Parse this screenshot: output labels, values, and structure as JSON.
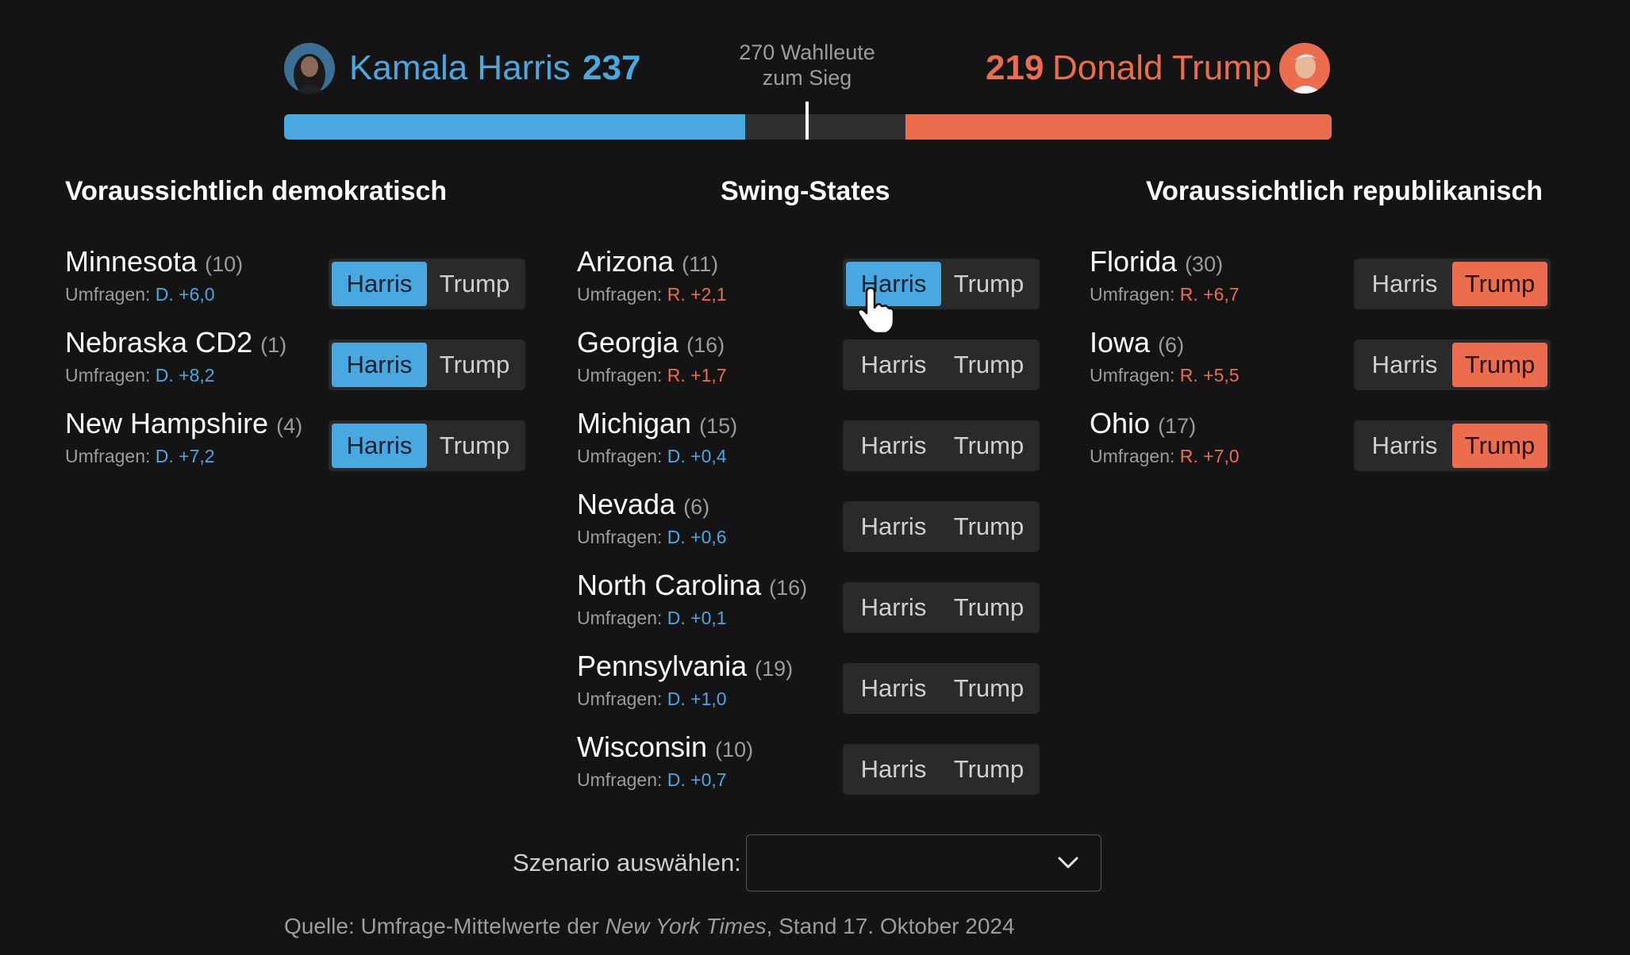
{
  "header": {
    "harris": {
      "name": "Kamala Harris",
      "votes": "237",
      "color": "#4aa8e0"
    },
    "trump": {
      "name": "Donald Trump",
      "votes": "219",
      "color": "#ec6c4e"
    },
    "threshold": {
      "line1": "270 Wahlleute",
      "line2": "zum Sieg"
    },
    "progress": {
      "total": 538,
      "harris": 237,
      "trump": 219,
      "threshold": 270
    }
  },
  "columns": {
    "dem": {
      "title": "Voraussichtlich demokratisch",
      "states": [
        {
          "name": "Minnesota",
          "ev": "(10)",
          "poll_prefix": "Umfragen:",
          "poll": "D. +6,0",
          "selected": "Harris"
        },
        {
          "name": "Nebraska CD2",
          "ev": "(1)",
          "poll_prefix": "Umfragen:",
          "poll": "D. +8,2",
          "selected": "Harris"
        },
        {
          "name": "New Hampshire",
          "ev": "(4)",
          "poll_prefix": "Umfragen:",
          "poll": "D. +7,2",
          "selected": "Harris"
        }
      ]
    },
    "swing": {
      "title": "Swing-States",
      "states": [
        {
          "name": "Arizona",
          "ev": "(11)",
          "poll_prefix": "Umfragen:",
          "poll": "R. +2,1",
          "selected": "Harris"
        },
        {
          "name": "Georgia",
          "ev": "(16)",
          "poll_prefix": "Umfragen:",
          "poll": "R. +1,7",
          "selected": ""
        },
        {
          "name": "Michigan",
          "ev": "(15)",
          "poll_prefix": "Umfragen:",
          "poll": "D. +0,4",
          "selected": ""
        },
        {
          "name": "Nevada",
          "ev": "(6)",
          "poll_prefix": "Umfragen:",
          "poll": "D. +0,6",
          "selected": ""
        },
        {
          "name": "North Carolina",
          "ev": "(16)",
          "poll_prefix": "Umfragen:",
          "poll": "D. +0,1",
          "selected": ""
        },
        {
          "name": "Pennsylvania",
          "ev": "(19)",
          "poll_prefix": "Umfragen:",
          "poll": "D. +1,0",
          "selected": ""
        },
        {
          "name": "Wisconsin",
          "ev": "(10)",
          "poll_prefix": "Umfragen:",
          "poll": "D. +0,7",
          "selected": ""
        }
      ]
    },
    "rep": {
      "title": "Voraussichtlich republikanisch",
      "states": [
        {
          "name": "Florida",
          "ev": "(30)",
          "poll_prefix": "Umfragen:",
          "poll": "R. +6,7",
          "selected": "Trump"
        },
        {
          "name": "Iowa",
          "ev": "(6)",
          "poll_prefix": "Umfragen:",
          "poll": "R. +5,5",
          "selected": "Trump"
        },
        {
          "name": "Ohio",
          "ev": "(17)",
          "poll_prefix": "Umfragen:",
          "poll": "R. +7,0",
          "selected": "Trump"
        }
      ]
    }
  },
  "toggle_labels": {
    "harris": "Harris",
    "trump": "Trump"
  },
  "scenario": {
    "label": "Szenario auswählen:",
    "value": ""
  },
  "source": {
    "prefix": "Quelle: Umfrage-Mittelwerte der ",
    "publication": "New York Times",
    "suffix": ", Stand 17. Oktober 2024"
  },
  "icons": [
    "harris-avatar",
    "trump-avatar",
    "chevron-down-icon",
    "hand-cursor-icon"
  ]
}
